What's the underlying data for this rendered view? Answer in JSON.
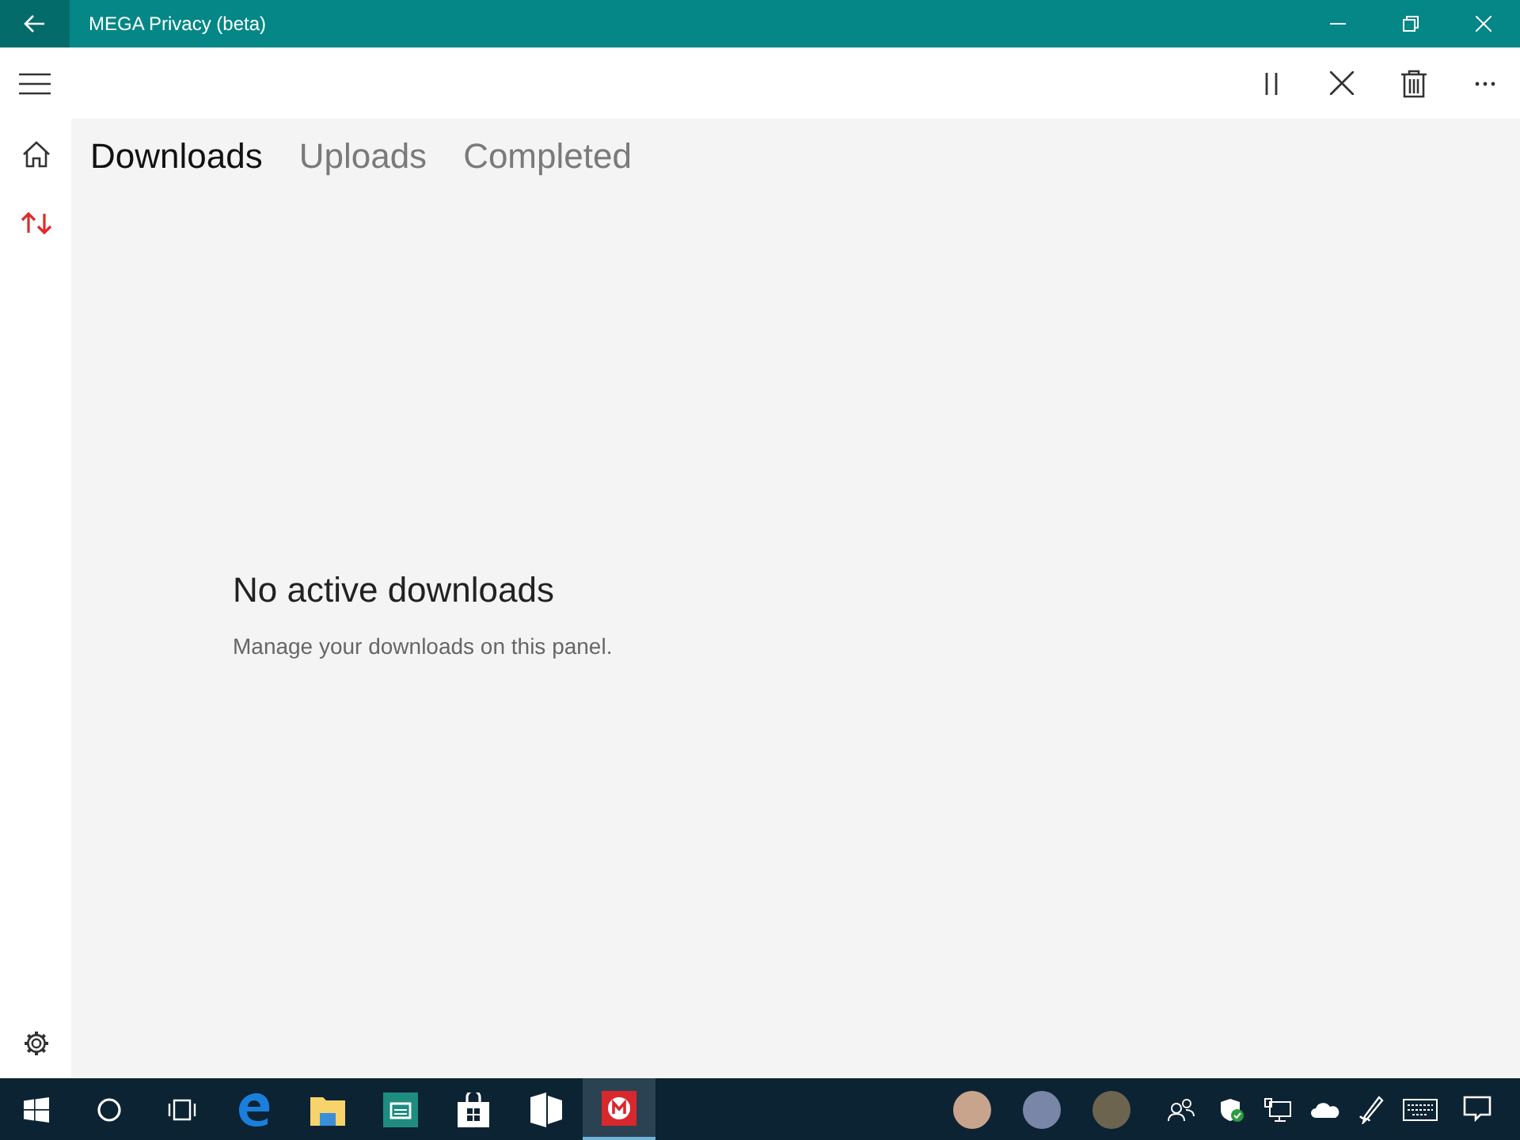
{
  "window": {
    "title": "MEGA Privacy (beta)"
  },
  "sidebar": {
    "items": [
      {
        "kind": "home",
        "selected": false
      },
      {
        "kind": "transfers",
        "selected": true
      }
    ]
  },
  "tabs": [
    {
      "label": "Downloads",
      "selected": true
    },
    {
      "label": "Uploads",
      "selected": false
    },
    {
      "label": "Completed",
      "selected": false
    }
  ],
  "empty_state": {
    "title": "No active downloads",
    "message": "Manage your downloads on this panel."
  },
  "taskbar": {
    "apps": [
      {
        "kind": "edge",
        "active": false
      },
      {
        "kind": "explorer",
        "active": false
      },
      {
        "kind": "app",
        "active": false
      },
      {
        "kind": "store",
        "active": false
      },
      {
        "kind": "tiles",
        "active": false
      },
      {
        "kind": "mega",
        "active": true
      }
    ]
  }
}
